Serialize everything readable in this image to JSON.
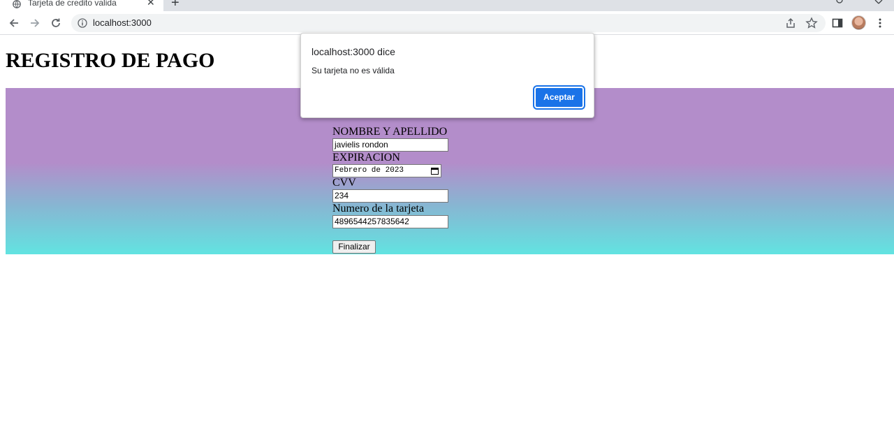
{
  "browser": {
    "tab_title": "Tarjeta de credito valida",
    "tab_close": "✕",
    "new_tab": "+",
    "url": "localhost:3000",
    "icons": [
      "back-arrow-icon",
      "forward-arrow-icon",
      "reload-icon",
      "info-icon",
      "share-icon",
      "star-icon",
      "side-panel-icon",
      "avatar",
      "kebab-menu-icon"
    ]
  },
  "page": {
    "title": "REGISTRO DE PAGO",
    "colors": {
      "band_top": "#b38dca",
      "band_bottom": "#62e3e1"
    }
  },
  "form": {
    "name_label": "NOMBRE Y APELLIDO",
    "name_value": "javielis rondon",
    "expiration_label": "EXPIRACION",
    "expiration_value": "Febrero de 2023",
    "cvv_label": "CVV",
    "cvv_value": "234",
    "card_label": "Numero de la tarjeta",
    "card_value": "4896544257835642",
    "submit_label": "Finalizar"
  },
  "dialog": {
    "title": "localhost:3000 dice",
    "message": "Su tarjeta no es válida",
    "ok_label": "Aceptar",
    "accent": "#1a73e8"
  }
}
